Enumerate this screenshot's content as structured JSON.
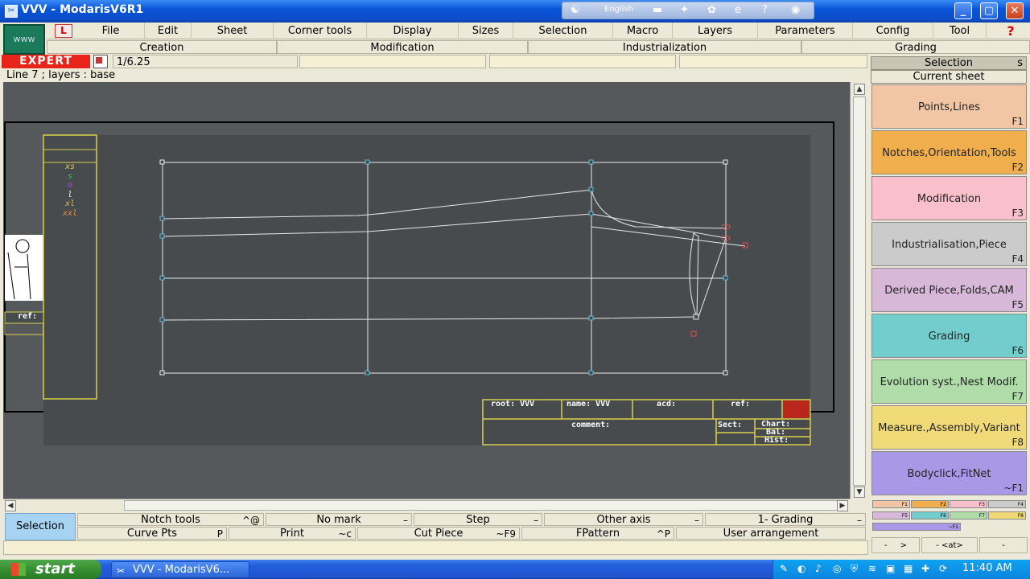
{
  "window": {
    "title": "VVV - ModarisV6R1",
    "lang": "English",
    "min": "_",
    "max": "▢",
    "close": "✕"
  },
  "menu": [
    "File",
    "Edit",
    "Sheet",
    "Corner tools",
    "Display",
    "Sizes",
    "Selection",
    "Macro",
    "Layers",
    "Parameters",
    "Config",
    "Tool"
  ],
  "help": "?",
  "www": "www",
  "lbtn": "L",
  "submenu": [
    "Creation",
    "Modification",
    "Industrialization",
    "Grading"
  ],
  "expert": "EXPERT",
  "scale": "1/6.25",
  "status": "Line 7   ;    layers :  base",
  "sizes": [
    "xs",
    "s",
    "m",
    "l",
    "xl",
    "xxl"
  ],
  "size_colors": [
    "#e0d060",
    "#30c050",
    "#9050d0",
    "#f0f0f0",
    "#d0c040",
    "#e09040"
  ],
  "ref_label": "ref:",
  "titleblock": {
    "root": "root: VVV",
    "name": "name: VVV",
    "acd": "acd:",
    "ref": "ref:",
    "comment": "comment:",
    "sect": "Sect:",
    "chart": "Chart:",
    "bal": "Bal:",
    "hist": "Hist:"
  },
  "right": {
    "selection": "Selection",
    "s": "s",
    "current_sheet": "Current sheet",
    "buttons": [
      {
        "label": "Points,Lines",
        "key": "F1",
        "color": "#f2c6a4"
      },
      {
        "label": "Notches,Orientation,Tools",
        "key": "F2",
        "color": "#f0ae4c"
      },
      {
        "label": "Modification",
        "key": "F3",
        "color": "#f9c0cc"
      },
      {
        "label": "Industrialisation,Piece",
        "key": "F4",
        "color": "#cbcbcb"
      },
      {
        "label": "Derived Piece,Folds,CAM",
        "key": "F5",
        "color": "#d8b8d8"
      },
      {
        "label": "Grading",
        "key": "F6",
        "color": "#74cdcd"
      },
      {
        "label": "Evolution syst.,Nest Modif.",
        "key": "F7",
        "color": "#b0dcaa"
      },
      {
        "label": "Measure.,Assembly,Variant",
        "key": "F8",
        "color": "#f0da78"
      },
      {
        "label": "Bodyclick,FitNet",
        "key": "~F1",
        "color": "#a898e6"
      }
    ],
    "mini": [
      "F1",
      "F2",
      "F3",
      "F4",
      "F5",
      "F6",
      "F7",
      "F8",
      "~F1"
    ],
    "nav": [
      "-",
      ">",
      "-",
      "<at>",
      "-"
    ]
  },
  "bottom": {
    "selection": "Selection",
    "row1": [
      {
        "label": "Notch tools",
        "key": "^@"
      },
      {
        "label": "No mark",
        "key": "–"
      },
      {
        "label": "Step",
        "key": "–"
      },
      {
        "label": "Other axis",
        "key": "–"
      },
      {
        "label": "1- Grading",
        "key": "–"
      }
    ],
    "row2": [
      {
        "label": "Curve Pts",
        "key": "P"
      },
      {
        "label": "Print",
        "key": "~c"
      },
      {
        "label": "Cut Piece",
        "key": "~F9"
      },
      {
        "label": "FPattern",
        "key": "^P"
      },
      {
        "label": "User arrangement",
        "key": ""
      }
    ]
  },
  "taskbar": {
    "start": "start",
    "item": "VVV - ModarisV6...",
    "clock": "11:40 AM"
  }
}
